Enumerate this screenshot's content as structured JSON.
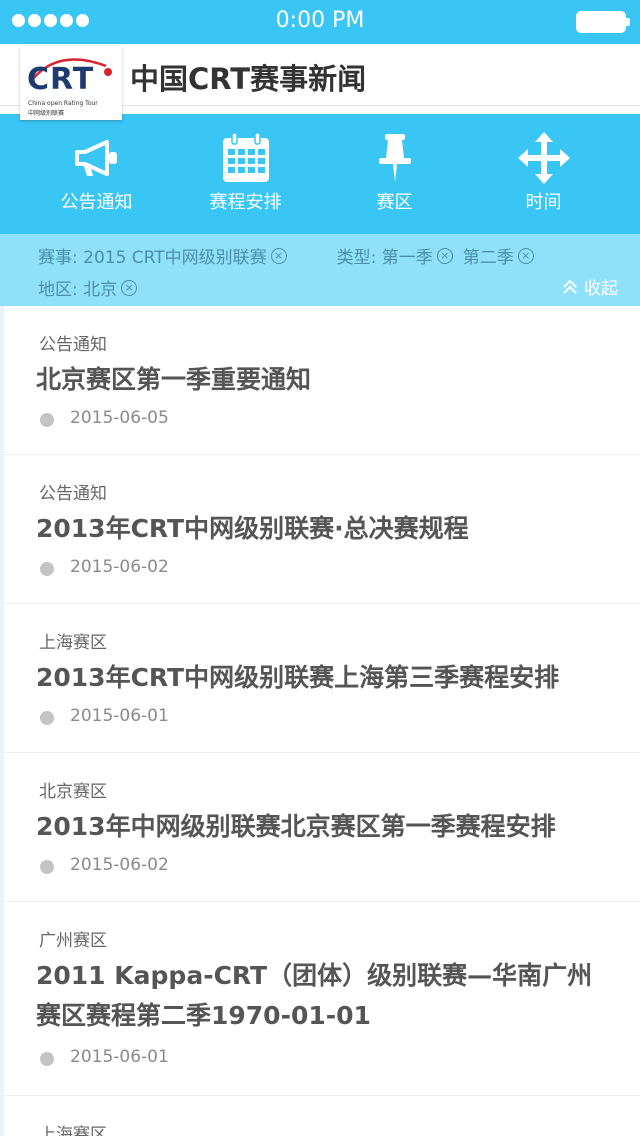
{
  "status_bar": {
    "time": "0:00 PM"
  },
  "header": {
    "title": "中国CRT赛事新闻",
    "logo_text": "CRT",
    "logo_sub": "China open Rating Tour",
    "logo_sub_cn": "中网级别联赛"
  },
  "nav": [
    {
      "label": "公告通知",
      "icon": "megaphone-icon"
    },
    {
      "label": "赛程安排",
      "icon": "calendar-icon"
    },
    {
      "label": "赛区",
      "icon": "pin-icon"
    },
    {
      "label": "时间",
      "icon": "move-arrows-icon"
    }
  ],
  "filters": {
    "event": "赛事: 2015 CRT中网级别联赛",
    "type_label": "类型: 第一季",
    "type_second": "第二季",
    "region": "地区: 北京",
    "collapse_label": "收起"
  },
  "news": [
    {
      "category": "公告通知",
      "title": "北京赛区第一季重要通知",
      "date": "2015-06-05"
    },
    {
      "category": "公告通知",
      "title": "2013年CRT中网级别联赛·总决赛规程",
      "date": "2015-06-02"
    },
    {
      "category": "上海赛区",
      "title": "2013年CRT中网级别联赛上海第三季赛程安排",
      "date": "2015-06-01"
    },
    {
      "category": "北京赛区",
      "title": "2013年中网级别联赛北京赛区第一季赛程安排",
      "date": "2015-06-02"
    },
    {
      "category": "广州赛区",
      "title": "2011 Kappa-CRT（团体）级别联赛—华南广州赛区赛程第二季1970-01-01",
      "date": "2015-06-01"
    },
    {
      "category": "上海赛区",
      "title": "",
      "date": ""
    }
  ],
  "colors": {
    "accent": "#3ac6f5",
    "filter_bg": "#8ee0fb"
  }
}
